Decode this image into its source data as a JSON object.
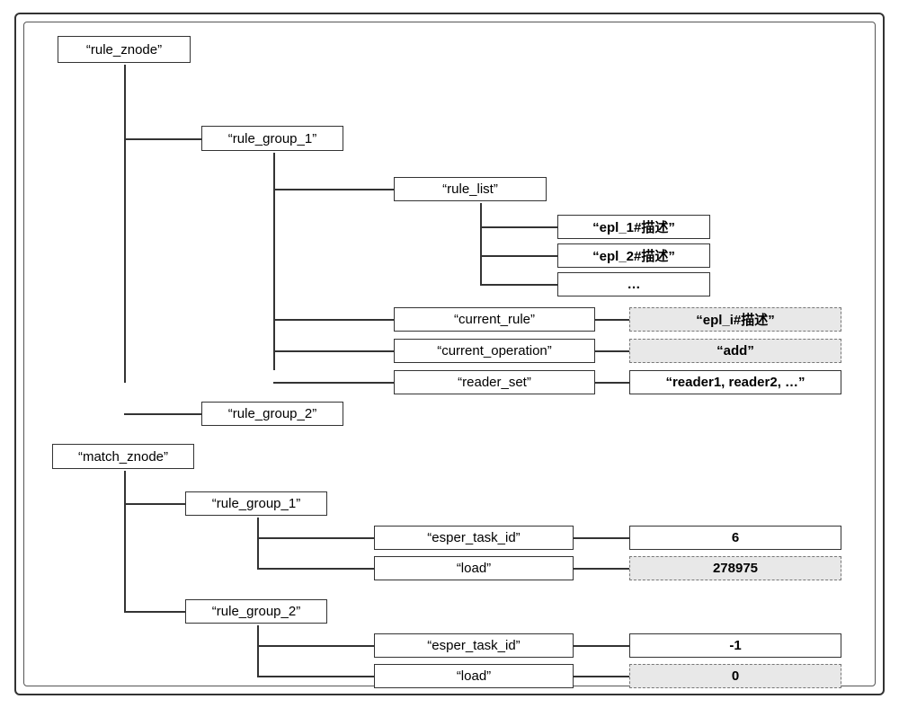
{
  "rule_znode": {
    "label": "“rule_znode”"
  },
  "rule_group_1": {
    "label": "“rule_group_1”"
  },
  "rule_list": {
    "label": "“rule_list”",
    "items": [
      "“epl_1#描述”",
      "“epl_2#描述”",
      "…"
    ]
  },
  "current_rule": {
    "label": "“current_rule”",
    "value": "“epl_i#描述”"
  },
  "current_operation": {
    "label": "“current_operation”",
    "value": "“add”"
  },
  "reader_set": {
    "label": "“reader_set”",
    "value": "“reader1, reader2, …”"
  },
  "rule_group_2": {
    "label": "“rule_group_2”"
  },
  "match_znode": {
    "label": "“match_znode”"
  },
  "m_rule_group_1": {
    "label": "“rule_group_1”",
    "esper_task_id": {
      "label": "“esper_task_id”",
      "value": "6"
    },
    "load": {
      "label": "“load”",
      "value": "278975"
    }
  },
  "m_rule_group_2": {
    "label": "“rule_group_2”",
    "esper_task_id": {
      "label": "“esper_task_id”",
      "value": "-1"
    },
    "load": {
      "label": "“load”",
      "value": "0"
    }
  }
}
